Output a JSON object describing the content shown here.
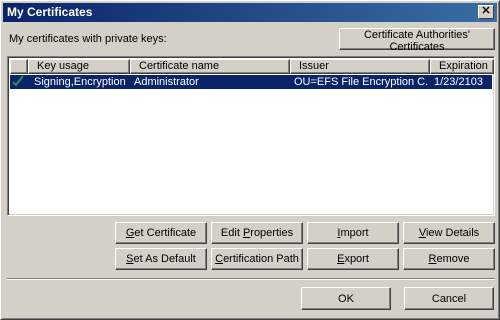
{
  "window": {
    "title": "My Certificates",
    "close_glyph": "✕"
  },
  "main": {
    "keys_label": "My certificates with private keys:",
    "ca_button": "Certificate Authorities' Certificates"
  },
  "table": {
    "columns": [
      "Key usage",
      "Certificate name",
      "Issuer",
      "Expiration"
    ],
    "rows": [
      {
        "key_usage": "Signing,Encryption",
        "name": "Administrator",
        "issuer": "OU=EFS File Encryption C...",
        "expiration": "1/23/2103",
        "selected": true
      }
    ]
  },
  "actions": {
    "get_certificate": {
      "pre": "",
      "key": "G",
      "post": "et Certificate"
    },
    "edit_properties": {
      "pre": "Edit ",
      "key": "P",
      "post": "roperties"
    },
    "import": {
      "pre": "",
      "key": "I",
      "post": "mport"
    },
    "view_details": {
      "pre": "",
      "key": "V",
      "post": "iew Details"
    },
    "set_as_default": {
      "pre": "",
      "key": "S",
      "post": "et As Default"
    },
    "certification_path": {
      "pre": "",
      "key": "C",
      "post": "ertification Path"
    },
    "export": {
      "pre": "",
      "key": "E",
      "post": "xport"
    },
    "remove": {
      "pre": "",
      "key": "R",
      "post": "emove"
    }
  },
  "footer": {
    "ok": "OK",
    "cancel": "Cancel"
  },
  "colors": {
    "title_gradient_start": "#0a246a",
    "title_gradient_end": "#3a6ea5",
    "selection": "#0a246a",
    "dialog_face": "#d4d0c8",
    "check_mark": "#2e8b57"
  }
}
